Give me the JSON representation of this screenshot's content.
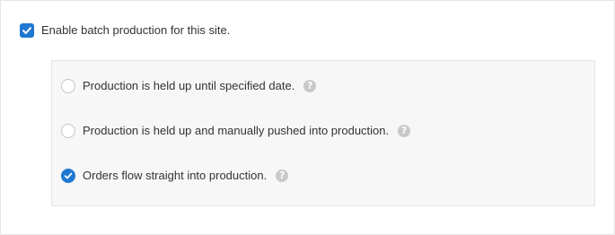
{
  "enable_batch": {
    "label": "Enable batch production for this site.",
    "checked": true
  },
  "production_options": [
    {
      "label": "Production is held up until specified date.",
      "selected": false,
      "help_icon": "question-circle-icon",
      "help_glyph": "?"
    },
    {
      "label": "Production is held up and manually pushed into production.",
      "selected": false,
      "help_icon": "question-circle-icon",
      "help_glyph": "?"
    },
    {
      "label": "Orders flow straight into production.",
      "selected": true,
      "help_icon": "question-circle-icon",
      "help_glyph": "?"
    }
  ],
  "colors": {
    "accent": "#1e78d2",
    "help_icon": "#c9c9c9",
    "options_background": "#f7f7f7",
    "panel_border": "#e6e6e6"
  }
}
